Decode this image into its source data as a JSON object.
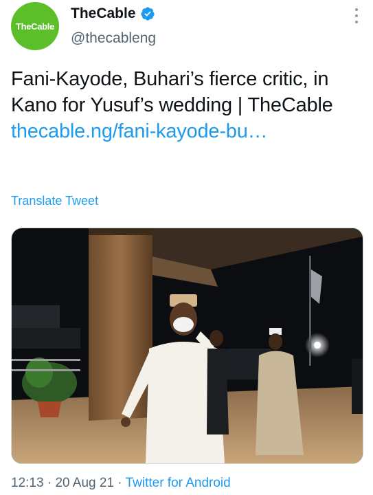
{
  "account": {
    "avatar_text": "TheCable",
    "display_name": "TheCable",
    "handle": "@thecableng",
    "brand_color": "#5cbf2a",
    "verified": true
  },
  "tweet": {
    "text": "Fani-Kayode, Buhari’s fierce critic, in Kano for Yusuf’s wedding | TheCable ",
    "link_text": "thecable.ng/fani-kayode-bu…",
    "translate_label": "Translate Tweet"
  },
  "media": {
    "description_icon": "photo"
  },
  "meta": {
    "time": "12:13",
    "separator": " · ",
    "date": "20 Aug 21",
    "source": "Twitter for Android"
  },
  "colors": {
    "link": "#1d9bf0",
    "secondary_text": "#536471"
  }
}
